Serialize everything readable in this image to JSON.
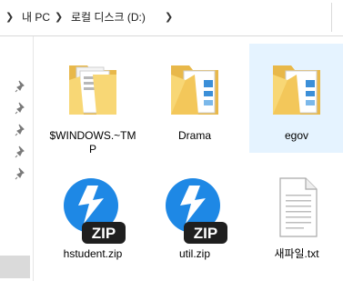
{
  "address": {
    "crumbs": [
      "내 PC",
      "로컬 디스크 (D:)"
    ]
  },
  "files": [
    {
      "name": "$WINDOWS.~TMP",
      "type": "folder",
      "variant": "docs",
      "selected": false
    },
    {
      "name": "Drama",
      "type": "folder",
      "variant": "docs-blue",
      "selected": false
    },
    {
      "name": "egov",
      "type": "folder",
      "variant": "docs-blue",
      "selected": true
    },
    {
      "name": "hstudent.zip",
      "type": "zip",
      "selected": false
    },
    {
      "name": "util.zip",
      "type": "zip",
      "selected": false
    },
    {
      "name": "새파일.txt",
      "type": "txt",
      "selected": false
    }
  ],
  "icons": {
    "zip_badge_text": "ZIP"
  },
  "colors": {
    "folder_yellow": "#f8d775",
    "folder_dark": "#e8b84a",
    "selection": "#e5f3ff",
    "zip_blue": "#1e88e5",
    "zip_dark": "#1f1f1f"
  }
}
